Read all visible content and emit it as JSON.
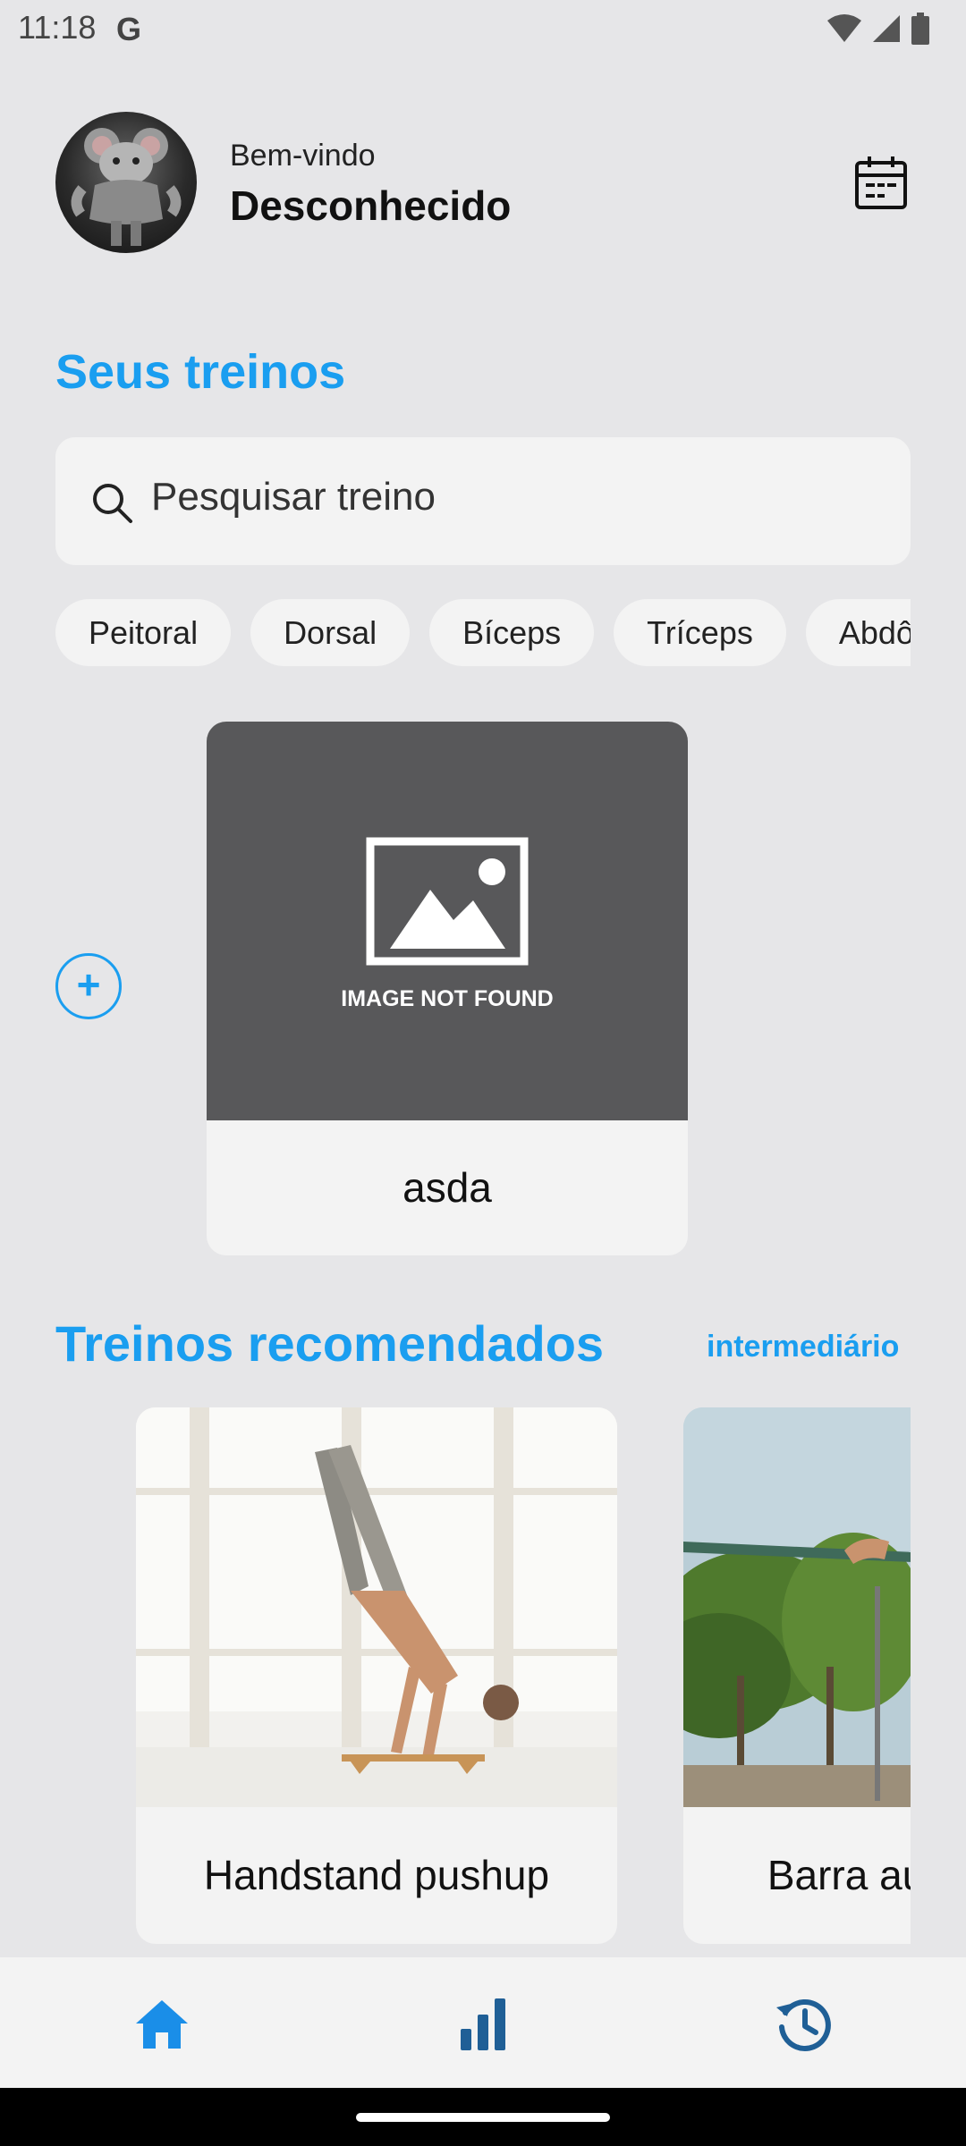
{
  "status_bar": {
    "time": "11:18",
    "g_label": "G"
  },
  "header": {
    "welcome": "Bem-vindo",
    "username": "Desconhecido"
  },
  "my_workouts": {
    "title": "Seus treinos",
    "search_placeholder": "Pesquisar treino",
    "filters": [
      "Peitoral",
      "Dorsal",
      "Bíceps",
      "Tríceps",
      "Abdômen"
    ],
    "add_label": "+",
    "cards": [
      {
        "name": "asda",
        "image_text": "IMAGE NOT FOUND"
      }
    ]
  },
  "recommended": {
    "title": "Treinos recomendados",
    "level": "intermediário",
    "cards": [
      {
        "name": "Handstand pushup"
      },
      {
        "name": "Barra australiana"
      }
    ]
  },
  "nav": {
    "items": [
      "home-icon",
      "stats-icon",
      "history-icon"
    ],
    "active": "home-icon"
  },
  "colors": {
    "accent": "#1a9ef0",
    "nav_active": "#1a8ee8",
    "nav_inactive": "#1f5f96",
    "background": "#e6e6e8",
    "card": "#f3f3f3"
  }
}
